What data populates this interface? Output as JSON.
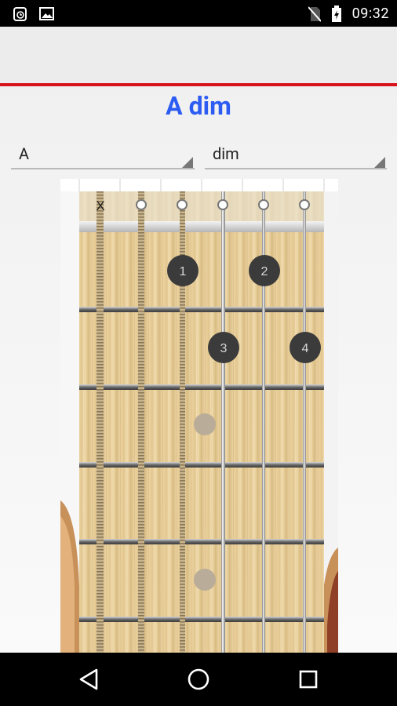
{
  "status_bar": {
    "time": "09:32",
    "icons": [
      "alarm-icon",
      "image-icon",
      "no-sim-icon",
      "battery-charging-icon"
    ]
  },
  "chord": {
    "title": "A dim",
    "root": "A",
    "type": "dim"
  },
  "fretboard": {
    "strings_open_state": [
      "X",
      "O",
      "O",
      "O",
      "O",
      "O"
    ],
    "finger_markers": [
      {
        "label": "1",
        "string": 3,
        "fret": 1
      },
      {
        "label": "2",
        "string": 5,
        "fret": 1
      },
      {
        "label": "3",
        "string": 4,
        "fret": 2
      },
      {
        "label": "4",
        "string": 6,
        "fret": 2
      }
    ],
    "inlays": [
      {
        "fret": 3
      },
      {
        "fret": 5
      }
    ]
  },
  "nav_bar": {
    "buttons": [
      "back-icon",
      "home-icon",
      "recents-icon"
    ]
  }
}
